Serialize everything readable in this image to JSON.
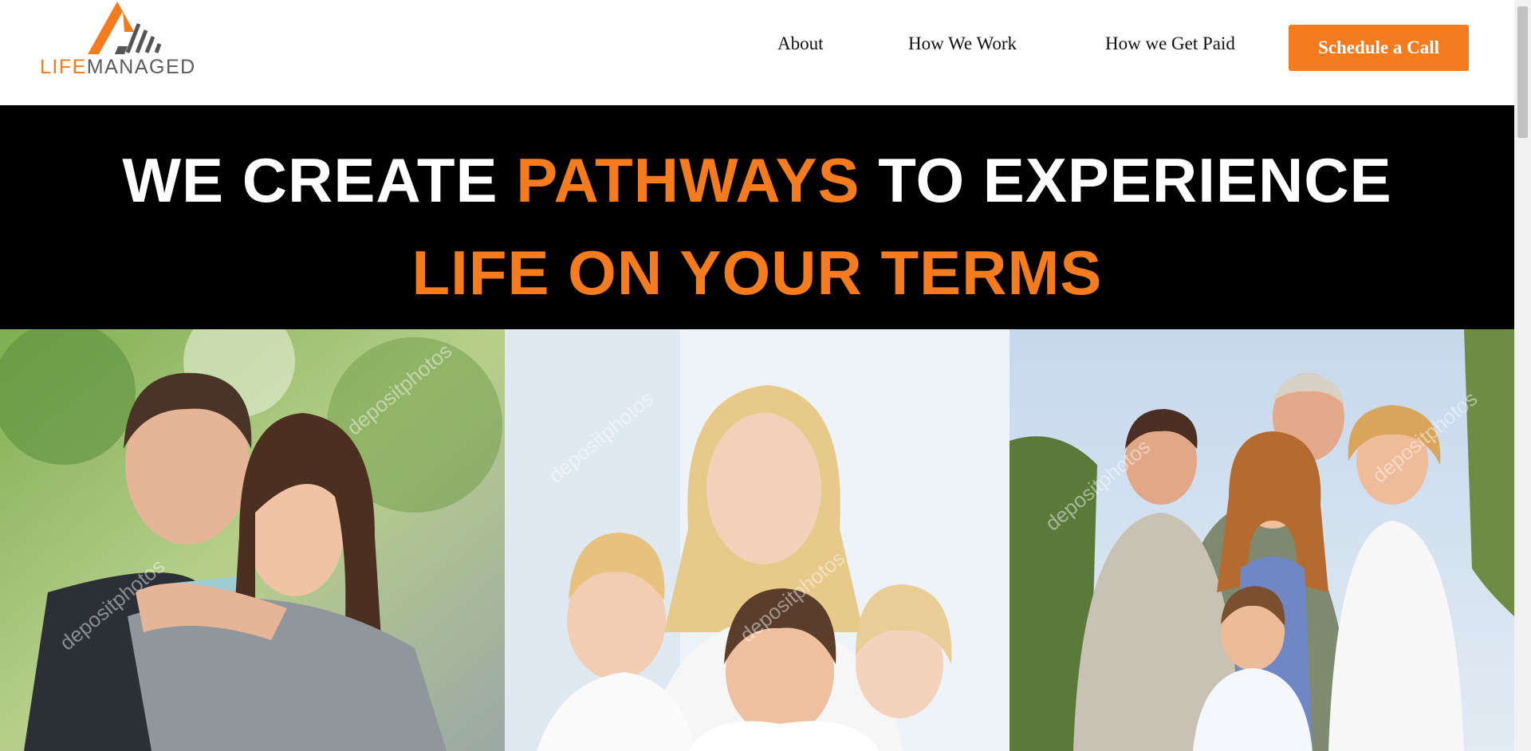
{
  "brand": {
    "logo_part1": "LIFE",
    "logo_part2": "MANAGED",
    "accent": "#f47c1f",
    "gray": "#5c5c5c"
  },
  "nav": {
    "items": [
      "About",
      "How We Work",
      "How we Get Paid"
    ],
    "cta_label": "Schedule a Call"
  },
  "hero": {
    "line1_pre": "WE CREATE ",
    "line1_highlight": "PATHWAYS",
    "line1_post": " TO EXPERIENCE",
    "line2": "LIFE ON YOUR TERMS"
  },
  "photos": {
    "watermark": "depositphotos",
    "items": [
      "couple-photo",
      "mother-children-photo",
      "family-outdoor-photo"
    ]
  }
}
